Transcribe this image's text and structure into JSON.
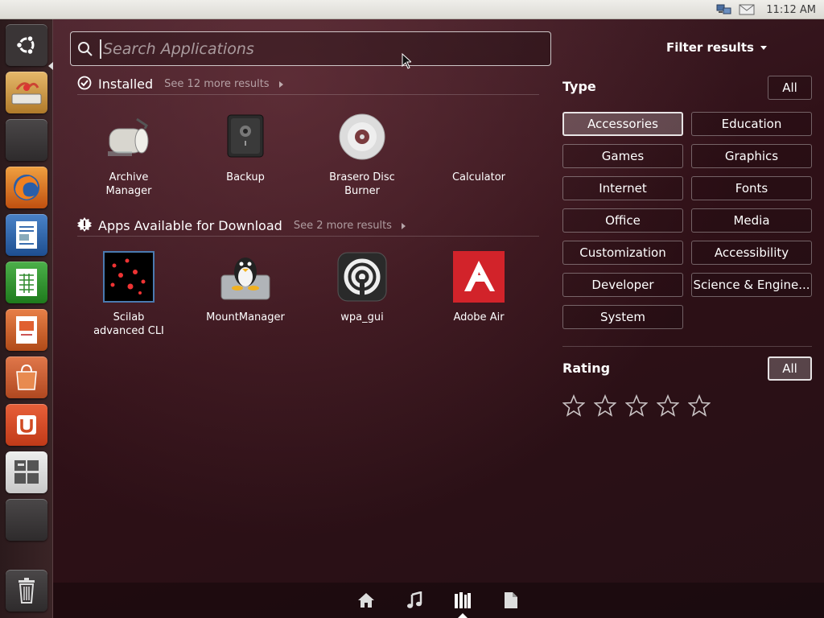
{
  "panel": {
    "clock": "11:12 AM",
    "tray_icons": [
      "network-icon",
      "mail-icon"
    ]
  },
  "launcher": {
    "items": [
      {
        "name": "ubuntu-logo-icon"
      },
      {
        "name": "install-icon"
      },
      {
        "name": "workspace-icon"
      },
      {
        "name": "firefox-icon"
      },
      {
        "name": "writer-icon"
      },
      {
        "name": "calc-icon"
      },
      {
        "name": "impress-icon"
      },
      {
        "name": "software-center-icon"
      },
      {
        "name": "ubuntu-one-icon"
      },
      {
        "name": "workspace-switcher-icon"
      },
      {
        "name": "blank-app-icon"
      }
    ],
    "trash": "trash-icon"
  },
  "search": {
    "placeholder": "Search Applications"
  },
  "sections": {
    "installed": {
      "title": "Installed",
      "more": "See 12 more results",
      "apps": [
        {
          "name": "Archive Manager"
        },
        {
          "name": "Backup"
        },
        {
          "name": "Brasero Disc Burner"
        },
        {
          "name": "Calculator"
        }
      ]
    },
    "download": {
      "title": "Apps Available for Download",
      "more": "See 2 more results",
      "apps": [
        {
          "name": "Scilab advanced CLI"
        },
        {
          "name": "MountManager"
        },
        {
          "name": "wpa_gui"
        },
        {
          "name": "Adobe Air"
        }
      ]
    }
  },
  "filters": {
    "toggle_label": "Filter results",
    "type": {
      "title": "Type",
      "all_label": "All",
      "categories": [
        "Accessories",
        "Education",
        "Games",
        "Graphics",
        "Internet",
        "Fonts",
        "Office",
        "Media",
        "Customization",
        "Accessibility",
        "Developer",
        "Science & Engine...",
        "System"
      ],
      "selected": "Accessories"
    },
    "rating": {
      "title": "Rating",
      "all_label": "All",
      "stars": 5
    }
  },
  "lenses": [
    "home-lens-icon",
    "music-lens-icon",
    "applications-lens-icon",
    "files-lens-icon"
  ],
  "active_lens": "applications-lens-icon"
}
